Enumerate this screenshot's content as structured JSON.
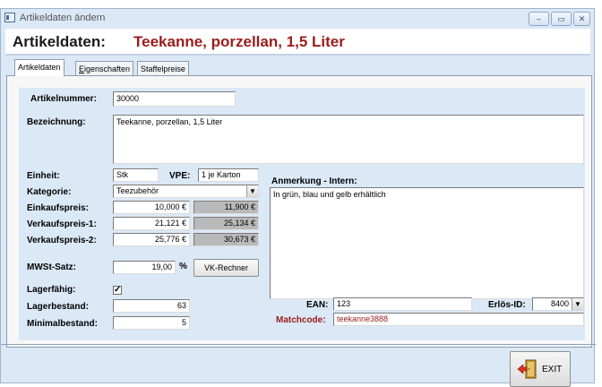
{
  "window": {
    "title": "Artikeldaten ändern",
    "controls": {
      "minimize": "‒",
      "maximize": "▭",
      "close": "✕"
    }
  },
  "header": {
    "label": "Artikeldaten:",
    "name": "Teekanne, porzellan, 1,5 Liter"
  },
  "tabs": [
    {
      "label": "Artikeldaten",
      "active": true
    },
    {
      "label_underline": "E",
      "label_rest": "igenschaften",
      "active": false
    },
    {
      "label": "Staffelpreise",
      "active": false
    }
  ],
  "form": {
    "artikelnummer": {
      "label": "Artikelnummer:",
      "value": "30000"
    },
    "bezeichnung": {
      "label": "Bezeichnung:",
      "value": "Teekanne, porzellan, 1,5 Liter"
    },
    "einheit": {
      "label": "Einheit:",
      "value": "Stk"
    },
    "vpe": {
      "label": "VPE:",
      "value": "1 je Karton"
    },
    "kategorie": {
      "label": "Kategorie:",
      "value": "Teezubehör"
    },
    "einkaufspreis": {
      "label": "Einkaufspreis:",
      "value": "10,000 €",
      "gross": "11,900 €"
    },
    "verkaufspreis1": {
      "label": "Verkaufspreis-1:",
      "value": "21,121 €",
      "gross": "25,134 €"
    },
    "verkaufspreis2": {
      "label": "Verkaufspreis-2:",
      "value": "25,776 €",
      "gross": "30,673 €"
    },
    "mwst": {
      "label": "MWSt-Satz:",
      "value": "19,00",
      "unit": "%"
    },
    "vk_rechner": {
      "label": "VK-Rechner"
    },
    "lagerfaehig": {
      "label": "Lagerfähig:",
      "checked": true,
      "mark": "✓"
    },
    "lagerbestand": {
      "label": "Lagerbestand:",
      "value": "63"
    },
    "minimalbestand": {
      "label": "Minimalbestand:",
      "value": "5"
    },
    "anmerkung": {
      "label": "Anmerkung - Intern:",
      "value": "In grün, blau und gelb erhältlich"
    },
    "ean": {
      "label": "EAN:",
      "value": "123"
    },
    "erloes_id": {
      "label": "Erlös-ID:",
      "value": "8400"
    },
    "matchcode": {
      "label": "Matchcode:",
      "value": "teekanne3888"
    }
  },
  "footer": {
    "exit_label": "EXIT"
  },
  "colors": {
    "accent_red": "#9a1c1c",
    "window_bg": "#dbe8f6",
    "grey_field": "#b9b9b9"
  }
}
